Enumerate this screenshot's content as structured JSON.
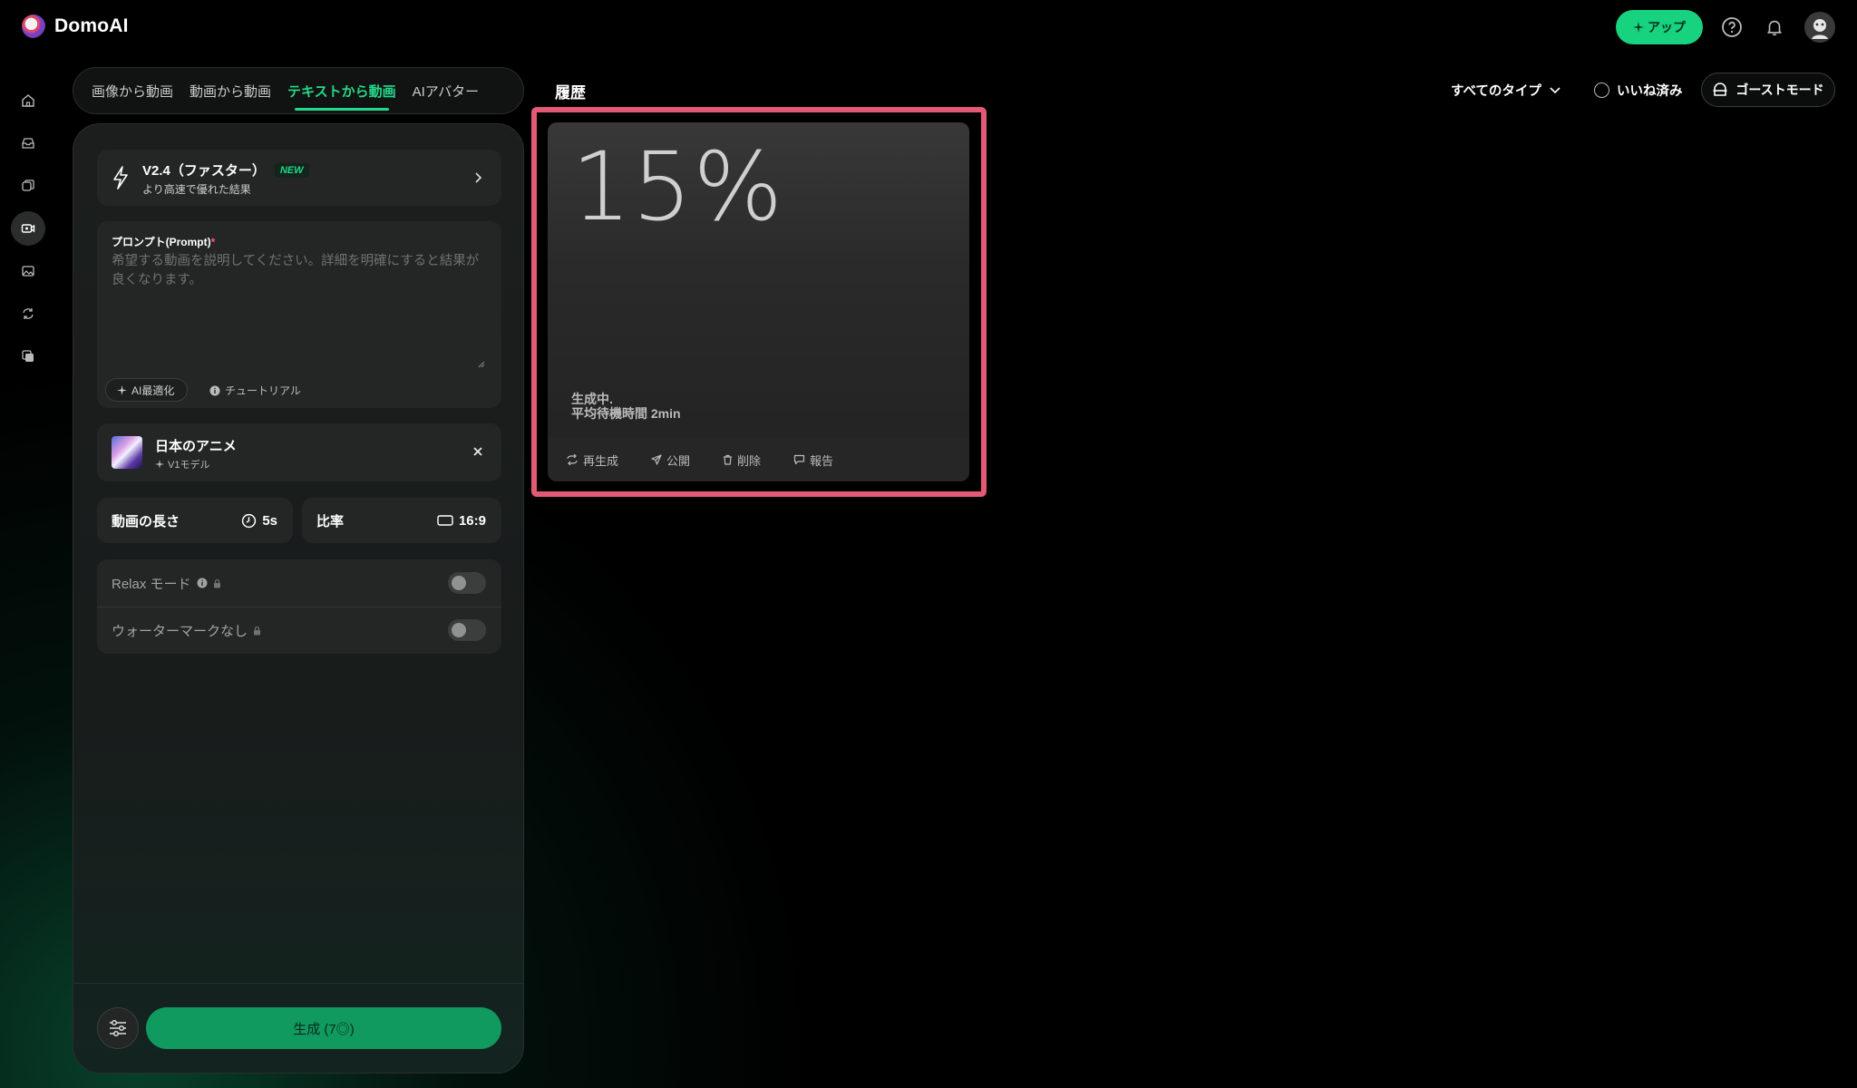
{
  "brand": {
    "name": "DomoAI"
  },
  "topbar": {
    "upgrade_label": "アップ"
  },
  "tabs": [
    {
      "label": "画像から動画"
    },
    {
      "label": "動画から動画"
    },
    {
      "label": "テキストから動画"
    },
    {
      "label": "AIアバター"
    }
  ],
  "model": {
    "title": "V2.4（ファスター）",
    "badge": "NEW",
    "subtitle": "より高速で優れた結果"
  },
  "prompt": {
    "label": "プロンプト(Prompt)",
    "required_mark": "*",
    "placeholder": "希望する動画を説明してください。詳細を明確にすると結果が良くなります。",
    "ai_optimize_label": "AI最適化",
    "tutorial_label": "チュートリアル"
  },
  "style": {
    "name": "日本のアニメ",
    "model_label": "V1モデル"
  },
  "duration": {
    "label": "動画の長さ",
    "value": "5s"
  },
  "ratio": {
    "label": "比率",
    "value": "16:9"
  },
  "toggles": {
    "relax_label": "Relax モード",
    "watermark_label": "ウォーターマークなし"
  },
  "generate": {
    "label": "生成 (7◎)"
  },
  "history": {
    "title": "履歴",
    "type_filter": "すべてのタイプ",
    "liked_label": "いいね済み",
    "ghost_mode_label": "ゴーストモード"
  },
  "job": {
    "progress_text": "15%",
    "status": "生成中.",
    "wait": "平均待機時間 2min",
    "actions": {
      "regenerate": "再生成",
      "publish": "公開",
      "delete": "削除",
      "report": "報告"
    }
  },
  "colors": {
    "accent": "#24d88a",
    "highlight": "#e45a75",
    "generate": "#109a60"
  }
}
